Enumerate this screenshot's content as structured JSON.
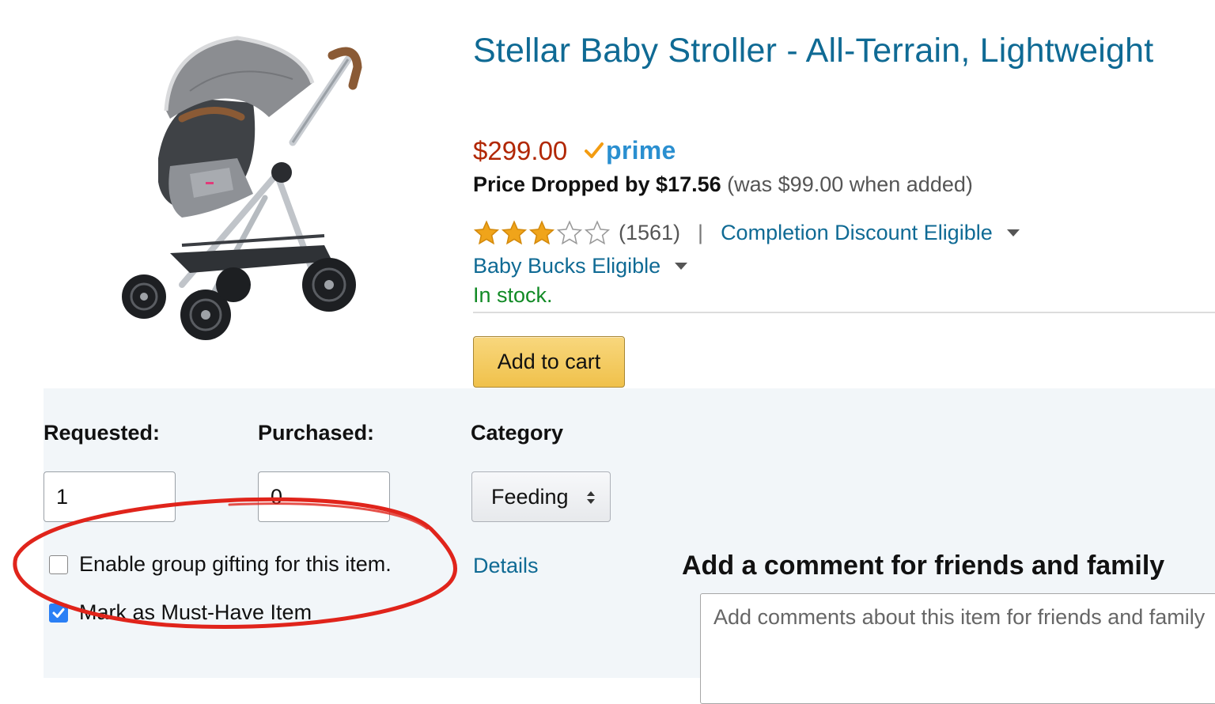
{
  "product": {
    "title": "Stellar Baby Stroller - All-Terrain, Lightweight",
    "price": "$299.00",
    "prime_label": "prime",
    "price_drop_label": "Price Dropped by $17.56",
    "price_was": "(was $99.00 when added)",
    "rating_stars": 3,
    "rating_max": 5,
    "review_count": "(1561)",
    "separator": "|",
    "completion_discount": "Completion Discount Eligible",
    "baby_bucks": "Baby Bucks Eligible",
    "stock": "In stock.",
    "add_to_cart": "Add to cart"
  },
  "form": {
    "requested_label": "Requested:",
    "requested_value": "1",
    "purchased_label": "Purchased:",
    "purchased_value": "0",
    "category_label": "Category",
    "category_value": "Feeding",
    "group_gifting_label": "Enable group gifting for this item.",
    "group_gifting_checked": false,
    "details_link": "Details",
    "must_have_label": "Mark as Must-Have Item",
    "must_have_checked": true,
    "comment_heading": "Add a comment for friends and family",
    "comment_placeholder": "Add comments about this item for friends and family"
  },
  "colors": {
    "link": "#0f6a94",
    "price": "#b12704",
    "in_stock": "#118a25",
    "star": "#f0a41a",
    "annotation": "#e0241b",
    "checkbox_checked": "#2a7ff5",
    "panel_bg": "#f2f6f9"
  }
}
